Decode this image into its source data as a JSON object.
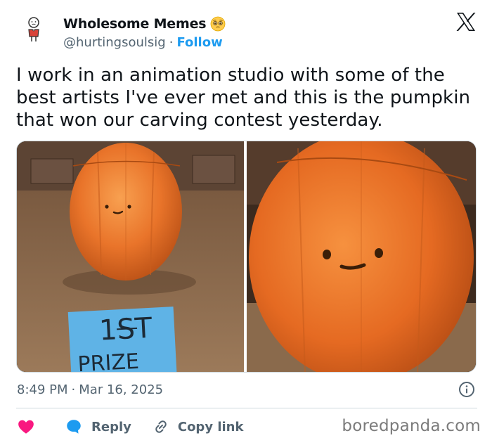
{
  "author": {
    "display_name": "Wholesome Memes",
    "handle": "@hurtingsoulsig",
    "separator": "·",
    "follow_label": "Follow"
  },
  "tweet": {
    "text": "I work in an animation studio with some of the best artists I've ever met and this is the pumpkin that won our carving contest yesterday.",
    "time": "8:49 PM",
    "date_separator": "·",
    "date": "Mar 16, 2025"
  },
  "media": {
    "sign_line1": "1ST",
    "sign_line2": "PRIZE"
  },
  "actions": {
    "reply_label": "Reply",
    "copy_label": "Copy link"
  },
  "watermark": "boredpanda.com",
  "icons": {
    "like": "heart-icon",
    "reply": "speech-bubble-icon",
    "copy": "link-icon",
    "info": "info-icon",
    "brand": "x-logo-icon",
    "emoji": "pleading-face-icon"
  },
  "colors": {
    "accent": "#1d9bf0",
    "like": "#f91880",
    "text": "#0f1419",
    "muted": "#536471"
  }
}
